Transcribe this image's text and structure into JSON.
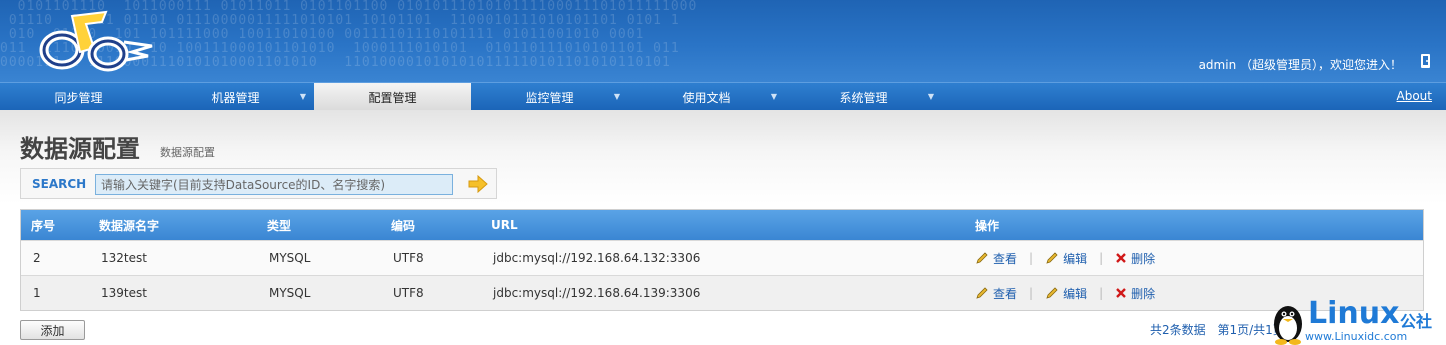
{
  "header": {
    "user_text": "admin （超级管理员），欢迎您进入！"
  },
  "nav": {
    "items": [
      {
        "label": "同步管理",
        "has_dropdown": false
      },
      {
        "label": "机器管理",
        "has_dropdown": true
      },
      {
        "label": "配置管理",
        "has_dropdown": false,
        "active": true
      },
      {
        "label": "监控管理",
        "has_dropdown": true
      },
      {
        "label": "使用文档",
        "has_dropdown": true
      },
      {
        "label": "系统管理",
        "has_dropdown": true
      }
    ],
    "about": "About"
  },
  "page": {
    "title": "数据源配置",
    "subtitle": "数据源配置"
  },
  "search": {
    "label": "SEARCH",
    "placeholder": "请输入关键字(目前支持DataSource的ID、名字搜索)"
  },
  "table": {
    "headers": [
      "序号",
      "数据源名字",
      "类型",
      "编码",
      "URL",
      "操作"
    ],
    "rows": [
      {
        "no": "2",
        "name": "132test",
        "type": "MYSQL",
        "encoding": "UTF8",
        "url": "jdbc:mysql://192.168.64.132:3306"
      },
      {
        "no": "1",
        "name": "139test",
        "type": "MYSQL",
        "encoding": "UTF8",
        "url": "jdbc:mysql://192.168.64.139:3306"
      }
    ],
    "actions": {
      "view": "查看",
      "edit": "编辑",
      "delete": "删除"
    }
  },
  "footer": {
    "add_label": "添加",
    "total": "共2条数据",
    "page_info": "第1页/共1页"
  },
  "watermark": {
    "brand": "Linux",
    "brand_cn": "公社",
    "url": "www.Linuxidc.com"
  },
  "colors": {
    "header_blue": "#2a74c6",
    "accent_blue": "#2c78c9",
    "link_blue": "#1f5fae",
    "delete_red": "#d01818"
  }
}
